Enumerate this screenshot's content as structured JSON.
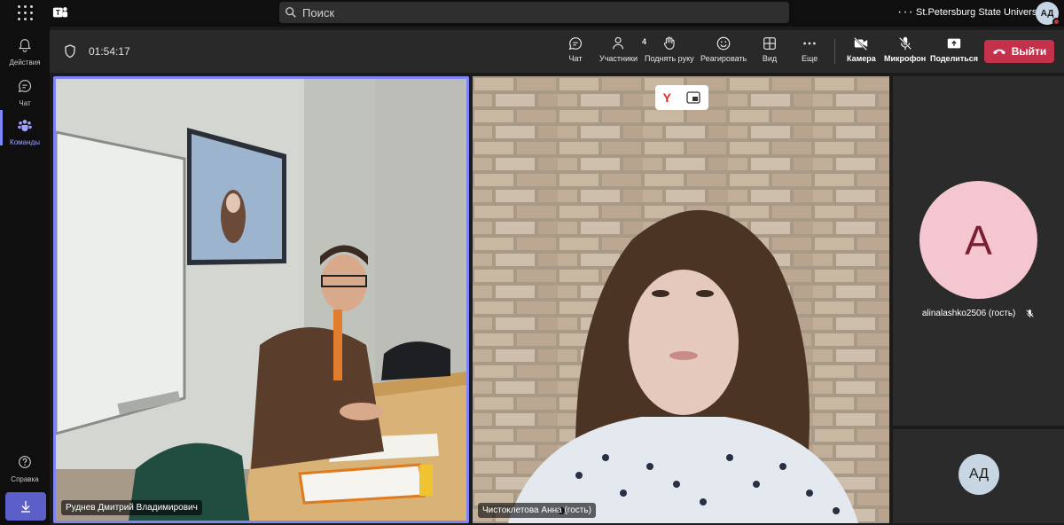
{
  "topbar": {
    "search_placeholder": "Поиск",
    "more_label": "···",
    "org_name": "St.Petersburg State University",
    "user_initials": "АД"
  },
  "rail": {
    "items": [
      {
        "label": "Действия",
        "icon": "bell-icon"
      },
      {
        "label": "Чат",
        "icon": "chat-icon"
      },
      {
        "label": "Команды",
        "icon": "teams-icon"
      },
      {
        "label": "Справка",
        "icon": "help-icon"
      }
    ]
  },
  "meeting": {
    "timer": "01:54:17",
    "tools": {
      "chat": "Чат",
      "participants": "Участники",
      "participants_count": "4",
      "raise_hand": "Поднять руку",
      "react": "Реагировать",
      "view": "Вид",
      "more": "Еще",
      "camera": "Камера",
      "mic": "Микрофон",
      "share": "Поделиться"
    },
    "leave_label": "Выйти"
  },
  "tiles": {
    "main_left_name": "Руднев Дмитрий Владимирович",
    "main_right_name": "Чистоклетова Анна (гость)",
    "yandex_logo": "Y",
    "side_avatar_letter": "A",
    "side_name": "alinalashko2506 (гость)",
    "self_initials": "АД"
  },
  "colors": {
    "accent": "#7f85f5",
    "leave": "#c4314b",
    "rail_bg": "#0f0f0f",
    "toolbar_bg": "#292929"
  }
}
